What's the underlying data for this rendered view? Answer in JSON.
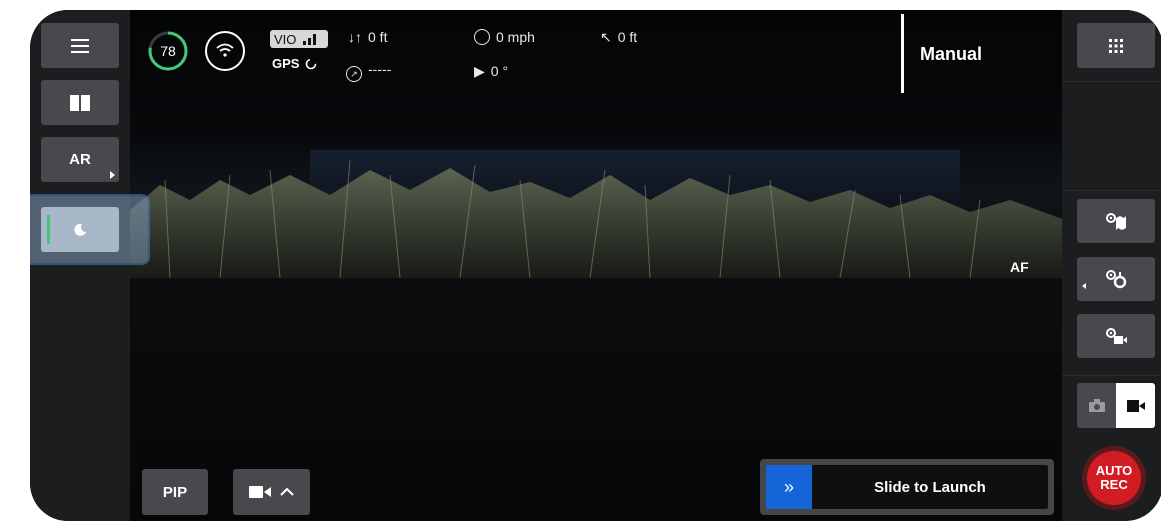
{
  "left_panel": {
    "items": [
      {
        "name": "menu",
        "icon": "hamburger-menu-icon"
      },
      {
        "name": "split-view",
        "icon": "split-view-icon"
      },
      {
        "name": "ar",
        "label": "AR"
      },
      {
        "name": "night-mode",
        "icon": "moon-icon"
      }
    ]
  },
  "hud": {
    "battery_percent": "78",
    "vio_label": "VIO",
    "gps_label": "GPS",
    "altitude": "0 ft",
    "heading": "-----",
    "speed": "0 mph",
    "camera_tilt": "0 °",
    "distance": "0 ft",
    "mode_label": "Manual",
    "focus_label": "AF"
  },
  "bottom": {
    "pip_label": "PIP",
    "slide_label": "Slide to Launch",
    "slide_arrows": "»"
  },
  "right_panel": {
    "icons": [
      "grid-menu-icon",
      "map-settings-icon",
      "flight-settings-icon",
      "camera-settings-icon",
      "photo-mode-icon",
      "video-mode-icon"
    ],
    "rec_label_line1": "AUTO",
    "rec_label_line2": "REC"
  },
  "colors": {
    "accent_green": "#44c77a",
    "selection_blue": "#4a7fc0",
    "slide_blue": "#1565d8",
    "rec_red": "#d21c24"
  }
}
